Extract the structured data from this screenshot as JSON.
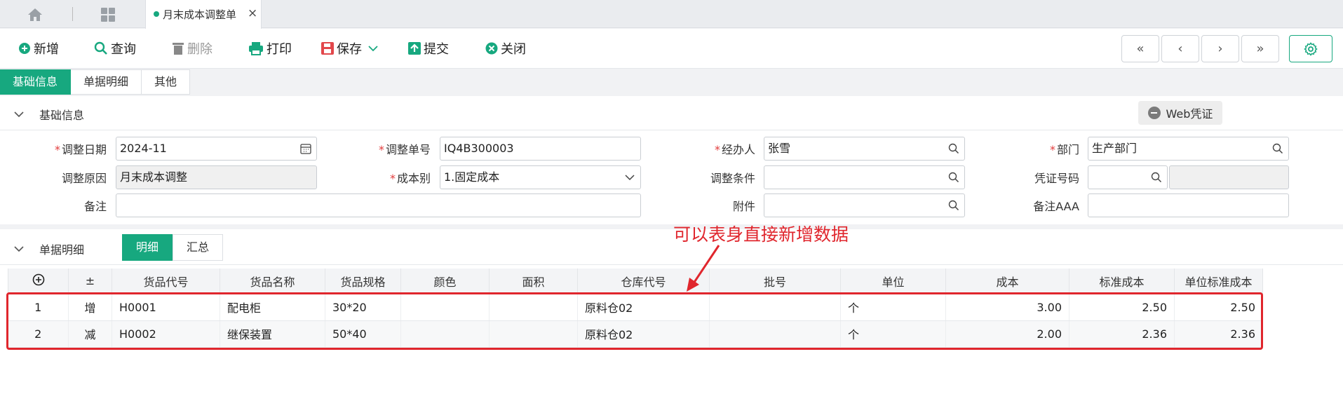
{
  "tabbar": {
    "home_icon": "home-icon",
    "apps_icon": "grid-icon",
    "doc_tab": {
      "label": "月末成本调整单",
      "close": "×"
    }
  },
  "toolbar": {
    "new": "新增",
    "query": "查询",
    "delete": "删除",
    "print": "打印",
    "save": "保存",
    "submit": "提交",
    "close": "关闭",
    "nav": [
      "«",
      "‹",
      "›",
      "»"
    ]
  },
  "section_tabs": [
    "基础信息",
    "单据明细",
    "其他"
  ],
  "basic": {
    "title": "基础信息",
    "web_voucher": "Web凭证",
    "fields": {
      "adjust_date": {
        "label": "调整日期",
        "value": "2024-11"
      },
      "adjust_no": {
        "label": "调整单号",
        "value": "IQ4B300003"
      },
      "handler": {
        "label": "经办人",
        "value": "张雪"
      },
      "dept": {
        "label": "部门",
        "value": "生产部门"
      },
      "reason": {
        "label": "调整原因",
        "value": "月末成本调整"
      },
      "cost_type": {
        "label": "成本别",
        "value": "1.固定成本"
      },
      "condition": {
        "label": "调整条件",
        "value": ""
      },
      "voucher_no": {
        "label": "凭证号码",
        "value": ""
      },
      "remark": {
        "label": "备注",
        "value": ""
      },
      "attachment": {
        "label": "附件",
        "value": ""
      },
      "remark_aaa": {
        "label": "备注AAA",
        "value": ""
      }
    }
  },
  "detail": {
    "title": "单据明细",
    "subtabs": [
      "明细",
      "汇总"
    ],
    "annotation": "可以表身直接新增数据",
    "columns": [
      "⊕",
      "±",
      "货品代号",
      "货品名称",
      "货品规格",
      "颜色",
      "面积",
      "仓库代号",
      "批号",
      "单位",
      "成本",
      "标准成本",
      "单位标准成本"
    ],
    "rows": [
      [
        "1",
        "增",
        "H0001",
        "配电柜",
        "30*20",
        "",
        "",
        "原料仓02",
        "",
        "个",
        "3.00",
        "2.50",
        "2.50"
      ],
      [
        "2",
        "减",
        "H0002",
        "继保装置",
        "50*40",
        "",
        "",
        "原料仓02",
        "",
        "个",
        "2.00",
        "2.36",
        "2.36"
      ]
    ]
  },
  "colors": {
    "accent": "#17a87f",
    "required": "#e23b3b",
    "annotation": "#e0262d"
  }
}
